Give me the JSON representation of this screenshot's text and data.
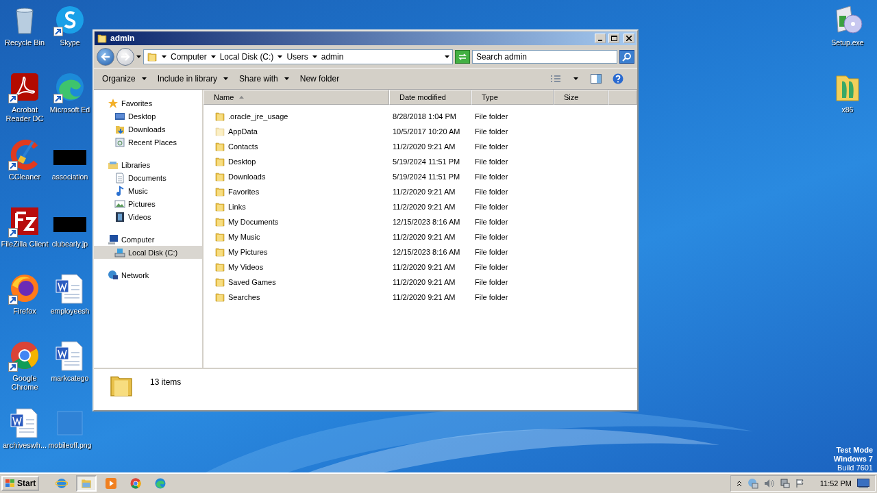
{
  "desktop": {
    "columns": [
      [
        {
          "label": "Recycle Bin",
          "kind": "recycle",
          "shortcut": false
        },
        {
          "label": "Acrobat Reader DC",
          "kind": "acrobat",
          "shortcut": true
        },
        {
          "label": "CCleaner",
          "kind": "ccleaner",
          "shortcut": true
        },
        {
          "label": "FileZilla Client",
          "kind": "filezilla",
          "shortcut": true
        },
        {
          "label": "Firefox",
          "kind": "firefox",
          "shortcut": true
        },
        {
          "label": "Google Chrome",
          "kind": "chrome",
          "shortcut": true
        },
        {
          "label": "archiveswh...",
          "kind": "word",
          "shortcut": false
        }
      ],
      [
        {
          "label": "Skype",
          "kind": "skype",
          "shortcut": true
        },
        {
          "label": "Microsoft Ed",
          "kind": "edge",
          "shortcut": true
        },
        {
          "label": "association",
          "kind": "redacted",
          "shortcut": false
        },
        {
          "label": "clubearly.jp",
          "kind": "redacted",
          "shortcut": false
        },
        {
          "label": "employeesh",
          "kind": "word",
          "shortcut": false
        },
        {
          "label": "markcatego",
          "kind": "word",
          "shortcut": false
        },
        {
          "label": "mobileoff.png",
          "kind": "blank",
          "shortcut": false
        }
      ]
    ],
    "right_icons": [
      {
        "label": "Setup.exe",
        "kind": "setup",
        "shortcut": false
      },
      {
        "label": "x86",
        "kind": "appfolder",
        "shortcut": false
      }
    ],
    "notice": [
      "Test Mode",
      "Windows 7",
      "Build 7601"
    ]
  },
  "window": {
    "title": "admin",
    "breadcrumb": [
      "Computer",
      "Local Disk (C:)",
      "Users",
      "admin"
    ],
    "search": {
      "placeholder": "Search admin"
    },
    "toolbar": [
      {
        "label": "Organize",
        "dropdown": true
      },
      {
        "label": "Include in library",
        "dropdown": true
      },
      {
        "label": "Share with",
        "dropdown": true
      },
      {
        "label": "New folder",
        "dropdown": false
      }
    ],
    "nav": [
      {
        "label": "Favorites",
        "kind": "star",
        "children": [
          {
            "label": "Desktop",
            "kind": "desktop",
            "selected": false
          },
          {
            "label": "Downloads",
            "kind": "downloads",
            "selected": false
          },
          {
            "label": "Recent Places",
            "kind": "recent",
            "selected": false
          }
        ]
      },
      {
        "label": "Libraries",
        "kind": "libraries",
        "children": [
          {
            "label": "Documents",
            "kind": "documents",
            "selected": false
          },
          {
            "label": "Music",
            "kind": "music",
            "selected": false
          },
          {
            "label": "Pictures",
            "kind": "pictures",
            "selected": false
          },
          {
            "label": "Videos",
            "kind": "videos",
            "selected": false
          }
        ]
      },
      {
        "label": "Computer",
        "kind": "computer",
        "children": [
          {
            "label": "Local Disk (C:)",
            "kind": "disk",
            "selected": true
          }
        ]
      },
      {
        "label": "Network",
        "kind": "network"
      }
    ],
    "columns": [
      {
        "label": "Name",
        "sorted": true
      },
      {
        "label": "Date modified",
        "sorted": false
      },
      {
        "label": "Type",
        "sorted": false
      },
      {
        "label": "Size",
        "sorted": false
      }
    ],
    "files": [
      {
        "name": ".oracle_jre_usage",
        "date": "8/28/2018 1:04 PM",
        "type": "File folder",
        "hidden": false
      },
      {
        "name": "AppData",
        "date": "10/5/2017 10:20 AM",
        "type": "File folder",
        "hidden": true
      },
      {
        "name": "Contacts",
        "date": "11/2/2020 9:21 AM",
        "type": "File folder",
        "hidden": false
      },
      {
        "name": "Desktop",
        "date": "5/19/2024 11:51 PM",
        "type": "File folder",
        "hidden": false
      },
      {
        "name": "Downloads",
        "date": "5/19/2024 11:51 PM",
        "type": "File folder",
        "hidden": false
      },
      {
        "name": "Favorites",
        "date": "11/2/2020 9:21 AM",
        "type": "File folder",
        "hidden": false
      },
      {
        "name": "Links",
        "date": "11/2/2020 9:21 AM",
        "type": "File folder",
        "hidden": false
      },
      {
        "name": "My Documents",
        "date": "12/15/2023 8:16 AM",
        "type": "File folder",
        "hidden": false
      },
      {
        "name": "My Music",
        "date": "11/2/2020 9:21 AM",
        "type": "File folder",
        "hidden": false
      },
      {
        "name": "My Pictures",
        "date": "12/15/2023 8:16 AM",
        "type": "File folder",
        "hidden": false
      },
      {
        "name": "My Videos",
        "date": "11/2/2020 9:21 AM",
        "type": "File folder",
        "hidden": false
      },
      {
        "name": "Saved Games",
        "date": "11/2/2020 9:21 AM",
        "type": "File folder",
        "hidden": false
      },
      {
        "name": "Searches",
        "date": "11/2/2020 9:21 AM",
        "type": "File folder",
        "hidden": false
      }
    ],
    "details": {
      "count": "13 items"
    }
  },
  "taskbar": {
    "start": "Start",
    "apps": [
      {
        "kind": "ie",
        "active": false
      },
      {
        "kind": "explorer",
        "active": true
      },
      {
        "kind": "media",
        "active": false
      },
      {
        "kind": "chrome",
        "active": false
      },
      {
        "kind": "edge",
        "active": false
      }
    ],
    "clock": "11:52 PM"
  }
}
